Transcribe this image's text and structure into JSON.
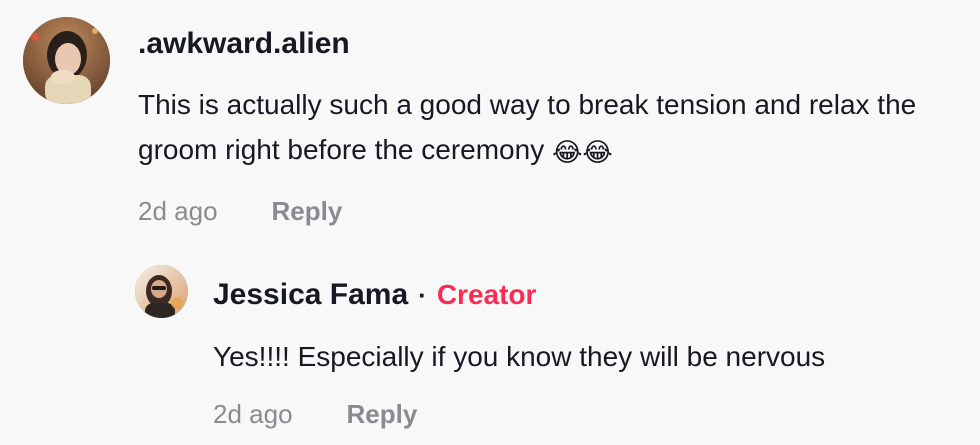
{
  "comment": {
    "username": ".awkward.alien",
    "text": "This is actually such a good way to break tension and relax the groom right before the ceremony",
    "emojis": "😂😂",
    "timestamp": "2d ago",
    "reply_label": "Reply",
    "avatar_icon": "user-avatar-photo"
  },
  "reply": {
    "username": "Jessica Fama",
    "separator": "·",
    "badge": "Creator",
    "badge_color": "#fe2c55",
    "text": "Yes!!!! Especially if you know they will be nervous",
    "timestamp": "2d ago",
    "reply_label": "Reply",
    "avatar_icon": "creator-avatar-photo"
  }
}
